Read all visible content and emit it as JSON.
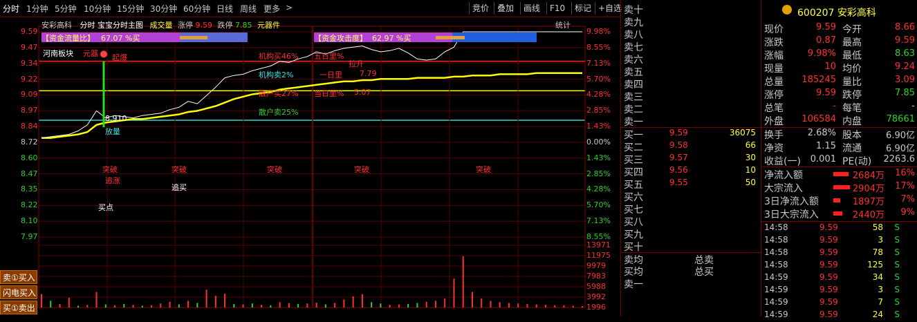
{
  "tabs": {
    "items": [
      "分时",
      "1分钟",
      "5分钟",
      "10分钟",
      "15分钟",
      "30分钟",
      "60分钟",
      "日线",
      "周线",
      "更多"
    ],
    "more_arrow": ">"
  },
  "toolbar": {
    "buttons": [
      "竞价",
      "叠加",
      "画线",
      "F10",
      "标记",
      "+自选"
    ]
  },
  "chart_header": {
    "stock_name": "安彩高科",
    "mode": "分时 宝宝分时主图",
    "vol_label": "成交量",
    "limit_up_label": "涨停",
    "limit_up": "9.59",
    "limit_down_label": "跌停",
    "limit_down": "7.85",
    "unit": "元器件",
    "stats": "统计"
  },
  "indicators": {
    "fund_flow_label": "【资金流量比】",
    "fund_flow_value": "67.07 %买",
    "fund_attack_label": "【资金攻击度】",
    "fund_attack_value": "62.97 %买",
    "sector": "河南板块"
  },
  "annotations": {
    "yuanqi": "元器",
    "qibao": "起爆",
    "jigou_buy": "机构买46%",
    "wuri_buy": "五日里%",
    "jigou_sell": "机构卖2%",
    "sanhu_buy": "散户买27%",
    "dangri": "当日里%",
    "sanhu_sell": "散户卖25%",
    "lakai": "拉升",
    "val_7_79": "7.79",
    "val_5_07": "5.07",
    "yiri": "一日里",
    "price_8_910": "8.910",
    "fangliang": "放量",
    "tupo1": "突破",
    "tupo2": "突破",
    "tupo3": "突破",
    "tupo4": "突破",
    "tupo5": "突破",
    "zhuizhang": "追涨",
    "zhuimai": "追买",
    "maidian": "买点"
  },
  "y_axis_price": [
    "9.59",
    "9.47",
    "9.34",
    "9.22",
    "9.09",
    "8.97",
    "8.84",
    "8.72",
    "8.60",
    "8.47",
    "8.35",
    "8.22",
    "8.10",
    "7.97"
  ],
  "y_axis_pct": [
    "9.98%",
    "8.55%",
    "7.13%",
    "5.70%",
    "4.28%",
    "2.85%",
    "1.43%",
    "0.00%",
    "1.43%",
    "2.85%",
    "4.28%",
    "5.70%",
    "7.13%",
    "8.55%"
  ],
  "y_axis_vol": [
    "13971",
    "11975",
    "9979",
    "7983",
    "5988",
    "3992",
    "1996"
  ],
  "side_buttons": [
    "卖①买入",
    "闪电买入",
    "买①卖出"
  ],
  "orderbook": {
    "sell_labels": [
      "卖十",
      "卖九",
      "卖八",
      "卖七",
      "卖六",
      "卖五",
      "卖四",
      "卖三",
      "卖二",
      "卖一"
    ],
    "buy": [
      {
        "label": "买一",
        "price": "9.59",
        "vol": "36075"
      },
      {
        "label": "买二",
        "price": "9.58",
        "vol": "66"
      },
      {
        "label": "买三",
        "price": "9.57",
        "vol": "30"
      },
      {
        "label": "买四",
        "price": "9.56",
        "vol": "10"
      },
      {
        "label": "买五",
        "price": "9.55",
        "vol": "50"
      },
      {
        "label": "买六",
        "price": "",
        "vol": ""
      },
      {
        "label": "买七",
        "price": "",
        "vol": ""
      },
      {
        "label": "买八",
        "price": "",
        "vol": ""
      },
      {
        "label": "买九",
        "price": "",
        "vol": ""
      },
      {
        "label": "买十",
        "price": "",
        "vol": ""
      }
    ],
    "sell_avg": "卖均",
    "total_sell": "总卖",
    "buy_avg": "买均",
    "total_buy": "总买",
    "footer": "卖一"
  },
  "quote": {
    "code_name": "600207 安彩高科",
    "rows": [
      {
        "k1": "现价",
        "v1": "9.59",
        "k2": "今开",
        "v2": "8.66",
        "c2": "#ff3030"
      },
      {
        "k1": "涨跌",
        "v1": "0.87",
        "k2": "最高",
        "v2": "9.59",
        "c2": "#ff3030"
      },
      {
        "k1": "涨幅",
        "v1": "9.98%",
        "k2": "最低",
        "v2": "8.63",
        "c2": "#2fd02f"
      },
      {
        "k1": "现量",
        "v1": "10",
        "k2": "均价",
        "v2": "9.24",
        "c2": "#ff3030"
      },
      {
        "k1": "总量",
        "v1": "185245",
        "k2": "量比",
        "v2": "3.09",
        "c2": "#ff3030"
      },
      {
        "k1": "涨停",
        "v1": "9.59",
        "k2": "跌停",
        "v2": "7.85",
        "c2": "#2fd02f"
      },
      {
        "k1": "总笔",
        "v1": "-",
        "k2": "每笔",
        "v2": "-",
        "c2": "#c8c8c8"
      },
      {
        "k1": "外盘",
        "v1": "106584",
        "k2": "内盘",
        "v2": "78661",
        "c2": "#2fd02f"
      }
    ],
    "rows2": [
      {
        "k1": "换手",
        "v1": "2.68%",
        "k2": "股本",
        "v2": "6.90亿"
      },
      {
        "k1": "净资",
        "v1": "1.15",
        "k2": "流通",
        "v2": "6.90亿"
      },
      {
        "k1": "收益(一)",
        "v1": "0.001",
        "k2": "PE(动)",
        "v2": "2263.6"
      }
    ],
    "flows": [
      {
        "label": "净流入额",
        "value": "2684万",
        "pct": "16%",
        "bar": 0.16
      },
      {
        "label": "大宗流入",
        "value": "2904万",
        "pct": "17%",
        "bar": 0.17
      },
      {
        "label": "3日净流入额",
        "value": "1897万",
        "pct": "7%",
        "bar": 0.07
      },
      {
        "label": "3日大宗流入",
        "value": "2440万",
        "pct": "9%",
        "bar": 0.09
      }
    ],
    "ticks": [
      {
        "t": "14:58",
        "p": "9.59",
        "v": "58",
        "s": "S"
      },
      {
        "t": "14:58",
        "p": "9.59",
        "v": "3",
        "s": "S"
      },
      {
        "t": "14:58",
        "p": "9.59",
        "v": "78",
        "s": "S"
      },
      {
        "t": "14:58",
        "p": "9.59",
        "v": "125",
        "s": "S"
      },
      {
        "t": "14:59",
        "p": "9.59",
        "v": "34",
        "s": "S"
      },
      {
        "t": "14:59",
        "p": "9.59",
        "v": "3",
        "s": "S"
      },
      {
        "t": "14:59",
        "p": "9.59",
        "v": "7",
        "s": "S"
      },
      {
        "t": "14:59",
        "p": "9.59",
        "v": "24",
        "s": "S"
      }
    ]
  },
  "colors": {
    "up": "#ff3030",
    "down": "#2fd02f",
    "grid": "#7a0000",
    "price_line": "#ffffff",
    "avg_line": "#ffff00",
    "vol_up": "#ff3030",
    "vol_down": "#2fd02f"
  },
  "chart_data": {
    "type": "line",
    "x_session": [
      "09:30",
      "11:30/13:00",
      "15:00"
    ],
    "prev_close": 8.72,
    "ylim": [
      7.85,
      9.59
    ],
    "price": [
      8.69,
      8.7,
      8.71,
      8.72,
      8.75,
      8.8,
      8.92,
      8.86,
      8.88,
      8.87,
      8.86,
      8.88,
      8.89,
      8.9,
      8.93,
      8.95,
      9.0,
      8.98,
      9.05,
      9.12,
      9.2,
      9.22,
      9.23,
      9.26,
      9.28,
      9.3,
      9.34,
      9.33,
      9.36,
      9.38,
      9.42,
      9.4,
      9.43,
      9.45,
      9.46,
      9.47,
      9.44,
      9.42,
      9.43,
      9.45,
      9.41,
      9.36,
      9.35,
      9.36,
      9.42,
      9.46,
      9.59,
      9.59,
      9.59,
      9.59,
      9.59,
      9.59,
      9.59,
      9.59,
      9.59,
      9.59,
      9.59,
      9.59,
      9.59,
      9.59
    ],
    "avg_price": [
      8.69,
      8.69,
      8.7,
      8.71,
      8.72,
      8.74,
      8.8,
      8.82,
      8.83,
      8.84,
      8.85,
      8.85,
      8.86,
      8.87,
      8.88,
      8.89,
      8.91,
      8.92,
      8.94,
      8.96,
      8.99,
      9.02,
      9.04,
      9.06,
      9.07,
      9.08,
      9.1,
      9.11,
      9.12,
      9.13,
      9.14,
      9.15,
      9.16,
      9.17,
      9.17,
      9.18,
      9.18,
      9.19,
      9.19,
      9.19,
      9.19,
      9.2,
      9.2,
      9.2,
      9.2,
      9.21,
      9.21,
      9.22,
      9.22,
      9.22,
      9.23,
      9.23,
      9.23,
      9.23,
      9.24,
      9.24,
      9.24,
      9.24,
      9.24,
      9.24
    ],
    "volume": [
      3000,
      1500,
      800,
      2200,
      400,
      600,
      3500,
      700,
      500,
      800,
      600,
      400,
      500,
      900,
      1300,
      700,
      1500,
      1000,
      4000,
      2600,
      3100,
      800,
      700,
      900,
      600,
      500,
      1200,
      1000,
      800,
      900,
      1100,
      700,
      1000,
      1800,
      2500,
      3000,
      1200,
      900,
      600,
      700,
      800,
      1000,
      1300,
      1500,
      2000,
      6500,
      11500,
      3500,
      2000,
      1500,
      1200,
      1000,
      900,
      800,
      700,
      600,
      500,
      500,
      400,
      300
    ],
    "volume_dir": [
      "u",
      "d",
      "u",
      "u",
      "d",
      "u",
      "u",
      "d",
      "u",
      "d",
      "u",
      "d",
      "u",
      "u",
      "u",
      "d",
      "u",
      "d",
      "u",
      "u",
      "u",
      "d",
      "u",
      "d",
      "u",
      "d",
      "u",
      "u",
      "d",
      "u",
      "u",
      "d",
      "u",
      "u",
      "u",
      "u",
      "d",
      "d",
      "u",
      "u",
      "d",
      "d",
      "u",
      "u",
      "u",
      "u",
      "u",
      "u",
      "u",
      "u",
      "u",
      "u",
      "u",
      "u",
      "u",
      "u",
      "u",
      "u",
      "u",
      "u"
    ]
  }
}
